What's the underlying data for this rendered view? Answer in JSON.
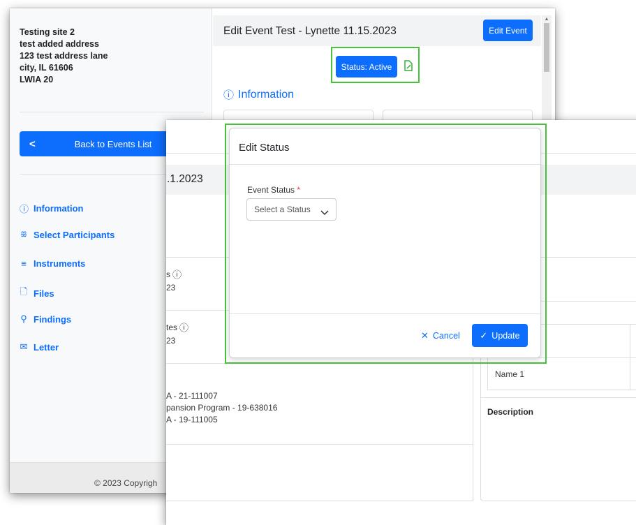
{
  "back_window": {
    "address": [
      "Testing site 2",
      "test added address",
      "123 test address lane",
      "city, IL 61606",
      "LWIA 20"
    ],
    "back_button": "Back to Events List",
    "nav": [
      {
        "label": "Information",
        "icon": "info-circle-icon"
      },
      {
        "label": "Select Participants",
        "icon": "people-icon"
      },
      {
        "label": "Instruments",
        "icon": "list-icon"
      },
      {
        "label": "Files",
        "icon": "file-icon"
      },
      {
        "label": "Findings",
        "icon": "search-icon"
      },
      {
        "label": "Letter",
        "icon": "envelope-icon"
      }
    ],
    "event_title": "Edit Event Test - Lynette 11.15.2023",
    "edit_event_button": "Edit Event",
    "status_button": "Status: Active",
    "info_heading": "Information",
    "footer": "© 2023 Copyrigh"
  },
  "front_window": {
    "date_fragment": ".1.2023",
    "field_fragment_1_label": "s",
    "field_fragment_1_value": "23",
    "field_fragment_2_label": "tes",
    "field_fragment_2_value": "23",
    "grants": [
      "A - 21-111007",
      "pansion Program - 19-638016",
      "A - 19-111005"
    ],
    "table_row": "Name 1",
    "description_label": "Description"
  },
  "modal": {
    "title": "Edit Status",
    "field_label": "Event Status",
    "required_marker": "*",
    "select_placeholder": "Select a Status",
    "cancel_label": "Cancel",
    "update_label": "Update"
  },
  "colors": {
    "accent": "#0d6efd",
    "highlight": "#46c23a",
    "sidebar_bg": "#f8f9fa"
  }
}
